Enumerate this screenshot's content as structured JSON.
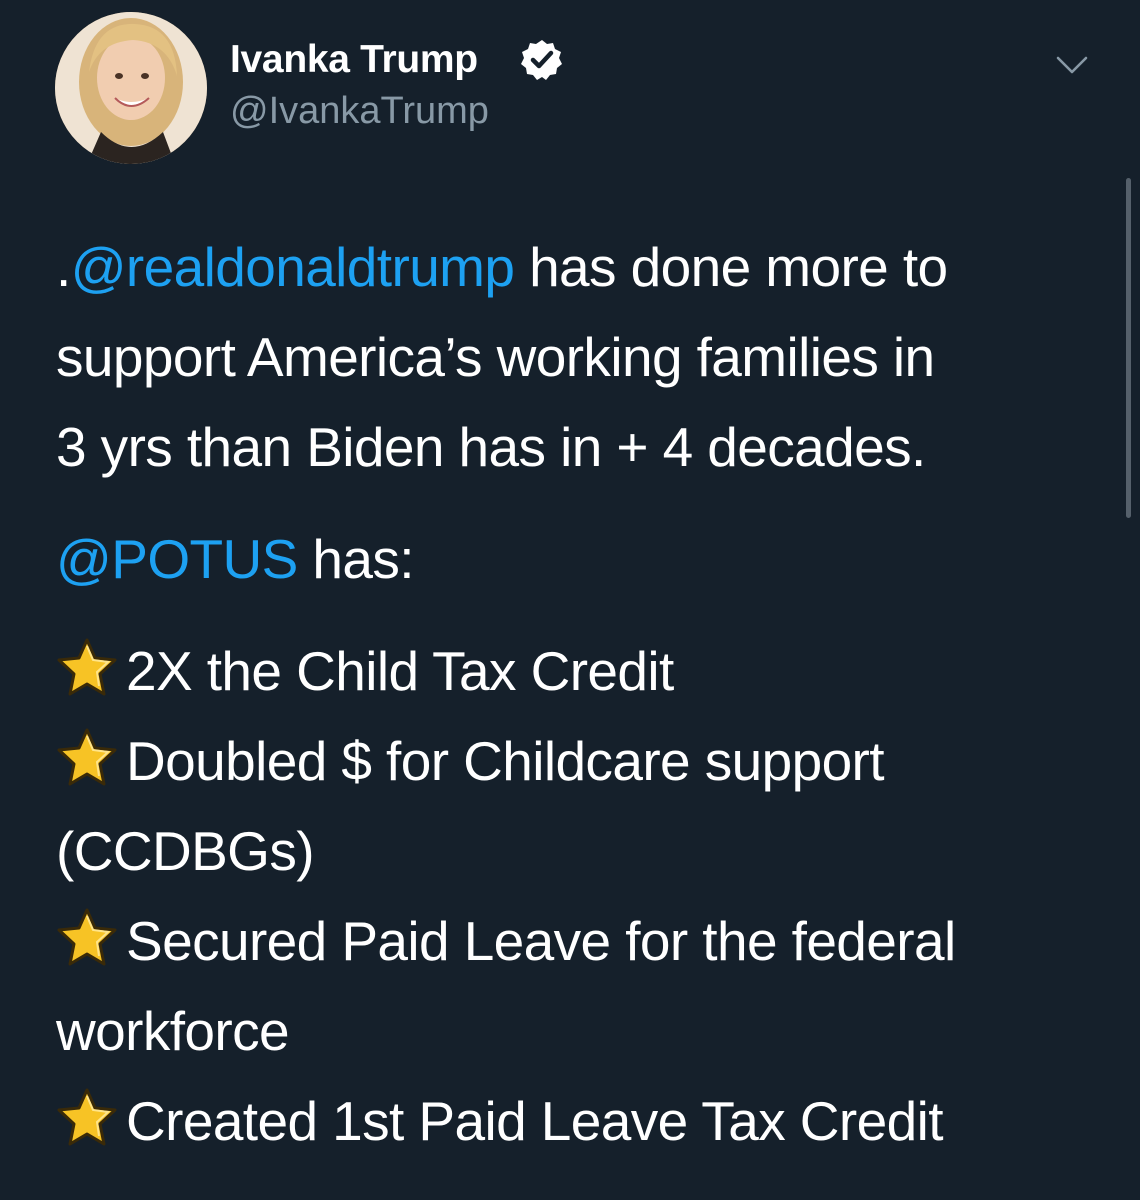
{
  "author": {
    "display_name": "Ivanka Trump",
    "handle": "@IvankaTrump",
    "verified": true,
    "avatar_icon": "profile-photo"
  },
  "menu_icon": "chevron-down-icon",
  "tweet": {
    "intro": {
      "prefix": ".",
      "mention": "@realdonaldtrump",
      "line1_rest": " has done more to",
      "line2": "support America’s working families in",
      "line3": "3 yrs than Biden has in + 4 decades."
    },
    "potus": {
      "mention": "@POTUS",
      "rest": " has:"
    },
    "bullet_icon": "star-emoji",
    "bullets": [
      {
        "line1": "2X the Child Tax Credit"
      },
      {
        "line1": "Doubled $ for Childcare support",
        "line2": "(CCDBGs)"
      },
      {
        "line1": "Secured Paid Leave for the federal",
        "line2": "workforce"
      },
      {
        "line1": "Created 1st Paid Leave Tax Credit"
      }
    ]
  },
  "colors": {
    "background": "#15202b",
    "text": "#ffffff",
    "secondary_text": "#8899a6",
    "link": "#1da1f2",
    "star": "#f7c325"
  }
}
